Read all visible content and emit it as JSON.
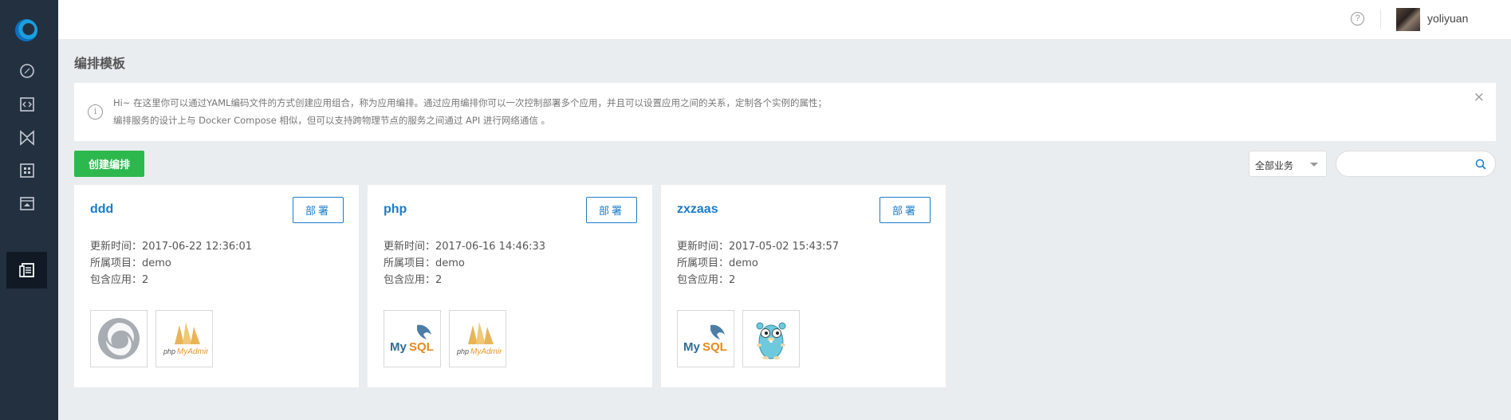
{
  "sidebar": {
    "items": [
      {
        "icon": "dashboard-icon"
      },
      {
        "icon": "code-icon"
      },
      {
        "icon": "bowtie-icon"
      },
      {
        "icon": "grid-icon"
      },
      {
        "icon": "archive-icon"
      },
      {
        "icon": "orchestration-icon",
        "active": true
      }
    ]
  },
  "topbar": {
    "help": "?",
    "username": "yoliyuan"
  },
  "page": {
    "title": "编排模板"
  },
  "notice": {
    "icon": "i",
    "line1": "Hi~ 在这里你可以通过YAML编码文件的方式创建应用组合，称为应用编排。通过应用编排你可以一次控制部署多个应用，并且可以设置应用之间的关系，定制各个实例的属性；",
    "line2": "编排服务的设计上与 Docker Compose 相似，但可以支持跨物理节点的服务之间通过 API 进行网络通信 。",
    "close": "×"
  },
  "toolbar": {
    "create_label": "创建编排",
    "business_select": "全部业务",
    "search_placeholder": ""
  },
  "cards": [
    {
      "name": "ddd",
      "deploy_label": "部署",
      "updated": "更新时间：2017-06-22 12:36:01",
      "project": "所属项目：demo",
      "apps": "包含应用：2",
      "app_icons": [
        "swirl-logo-icon",
        "phpmyadmin-icon"
      ]
    },
    {
      "name": "php",
      "deploy_label": "部署",
      "updated": "更新时间：2017-06-16 14:46:33",
      "project": "所属项目：demo",
      "apps": "包含应用：2",
      "app_icons": [
        "mysql-icon",
        "phpmyadmin-icon"
      ]
    },
    {
      "name": "zxzaas",
      "deploy_label": "部署",
      "updated": "更新时间：2017-05-02 15:43:57",
      "project": "所属项目：demo",
      "apps": "包含应用：2",
      "app_icons": [
        "mysql-icon",
        "golang-gopher-icon"
      ]
    }
  ],
  "app_labels": {
    "mysql_my": "My",
    "mysql_sql": "SQL",
    "phpmyadmin_php": "php",
    "phpmyadmin_rest": "MyAdmin"
  },
  "colors": {
    "sidebar_bg": "#23303f",
    "accent_blue": "#1a7cc9",
    "create_green": "#2db84d",
    "page_bg": "#e9edf0"
  }
}
